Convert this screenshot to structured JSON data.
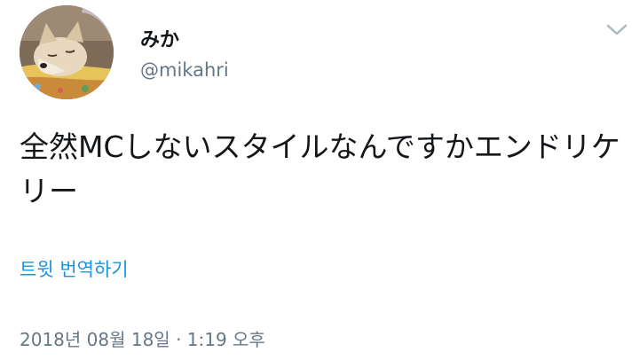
{
  "tweet": {
    "author": {
      "display_name": "みか",
      "handle": "@mikahri"
    },
    "text": "全然MCしないスタイルなんですかエンドリケリー",
    "translate_label": "트윗 번역하기",
    "timestamp": "2018년 08월 18일 · 1:19 오후"
  },
  "icons": {
    "menu": "chevron-down-icon"
  },
  "colors": {
    "link": "#1b95e0",
    "secondary_text": "#657786",
    "primary_text": "#14171a",
    "chevron": "#aab8c2"
  }
}
